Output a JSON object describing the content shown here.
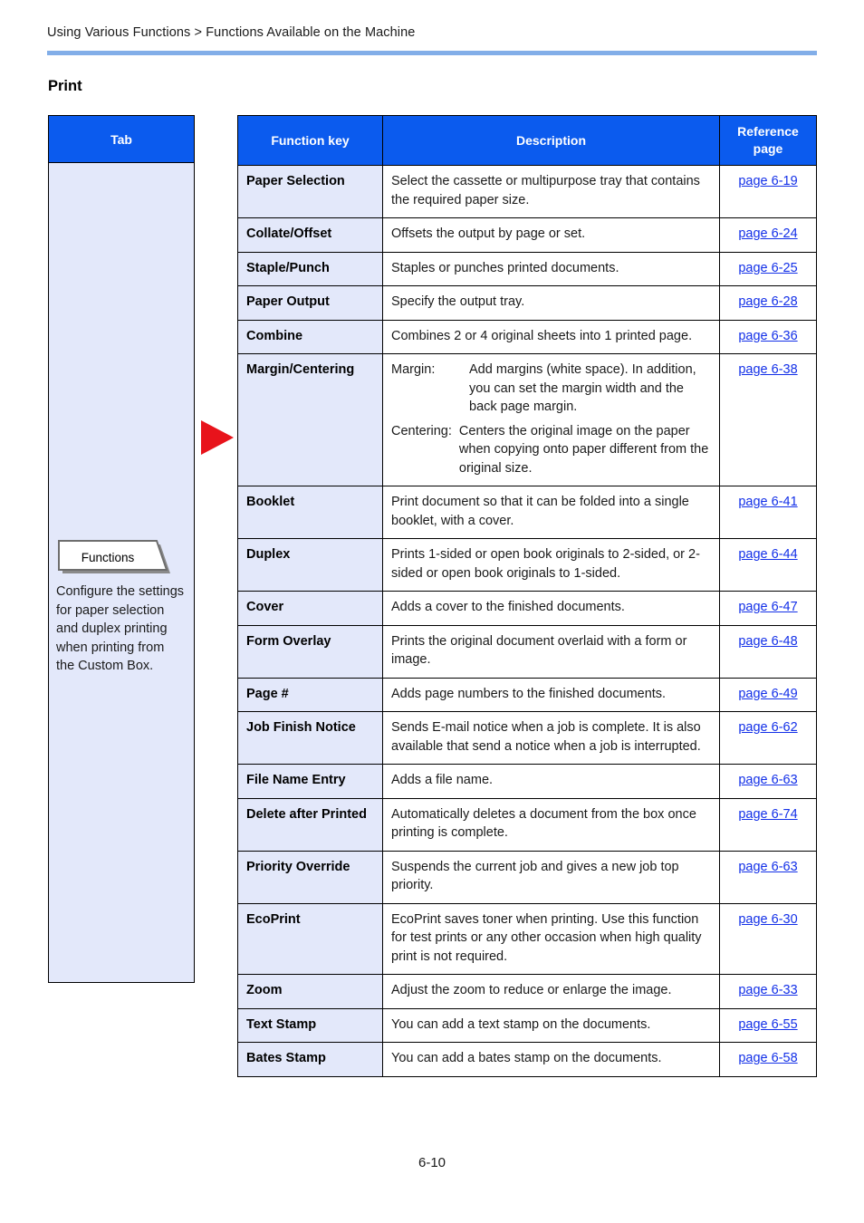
{
  "header": {
    "breadcrumb": "Using Various Functions > Functions Available on the Machine"
  },
  "section": {
    "title": "Print"
  },
  "tab_column": {
    "header": "Tab",
    "callout_label": "Functions",
    "description": "Configure the settings for paper selection and duplex printing when printing from the Custom Box."
  },
  "table": {
    "headers": {
      "function_key": "Function key",
      "description": "Description",
      "reference_page": "Reference page"
    },
    "rows": [
      {
        "key": "Paper Selection",
        "desc": "Select the cassette or multipurpose tray that contains the required paper size.",
        "ref": "page 6-19"
      },
      {
        "key": "Collate/Offset",
        "desc": "Offsets the output by page or set.",
        "ref": "page 6-24"
      },
      {
        "key": "Staple/Punch",
        "desc": "Staples or punches printed documents.",
        "ref": "page 6-25"
      },
      {
        "key": "Paper Output",
        "desc": "Specify the output tray.",
        "ref": "page 6-28"
      },
      {
        "key": "Combine",
        "desc": "Combines 2 or 4 original sheets into 1 printed page.",
        "ref": "page 6-36"
      },
      {
        "key": "Margin/Centering",
        "desc_parts": [
          {
            "label": "Margin:",
            "text": "Add margins (white space). In addition, you can set the margin width and the back page margin."
          },
          {
            "label": "Centering:",
            "text": "Centers the original image on the paper when copying onto paper different from the original size."
          }
        ],
        "ref": "page 6-38"
      },
      {
        "key": "Booklet",
        "desc": "Print document so that it can be folded into a single booklet, with a cover.",
        "ref": "page 6-41"
      },
      {
        "key": "Duplex",
        "desc": "Prints 1-sided or open book originals to 2-sided, or 2-sided or open book originals to 1-sided.",
        "ref": "page 6-44"
      },
      {
        "key": "Cover",
        "desc": "Adds a cover to the finished documents.",
        "ref": "page 6-47"
      },
      {
        "key": "Form Overlay",
        "desc": "Prints the original document overlaid with a form or image.",
        "ref": "page 6-48"
      },
      {
        "key": "Page #",
        "desc": "Adds page numbers to the finished documents.",
        "ref": "page 6-49"
      },
      {
        "key": "Job Finish Notice",
        "desc": "Sends E-mail notice when a job is complete. It is also available that send a notice when a job is interrupted.",
        "ref": "page 6-62"
      },
      {
        "key": "File Name Entry",
        "desc": "Adds a file name.",
        "ref": "page 6-63"
      },
      {
        "key": "Delete after Printed",
        "desc": "Automatically deletes a document from the box once printing is complete.",
        "ref": "page 6-74"
      },
      {
        "key": "Priority Override",
        "desc": "Suspends the current job and gives a new job top priority.",
        "ref": "page 6-63"
      },
      {
        "key": "EcoPrint",
        "desc": "EcoPrint saves toner when printing. Use this function for test prints or any other occasion when high quality print is not required.",
        "ref": "page 6-30"
      },
      {
        "key": "Zoom",
        "desc": "Adjust the zoom to reduce or enlarge the image.",
        "ref": "page 6-33"
      },
      {
        "key": "Text Stamp",
        "desc": "You can add a text stamp on the documents.",
        "ref": "page 6-55"
      },
      {
        "key": "Bates Stamp",
        "desc": "You can add a bates stamp on the documents.",
        "ref": "page 6-58"
      }
    ]
  },
  "footer": {
    "page_number": "6-10"
  },
  "colors": {
    "header_blue": "#0b5bee",
    "cell_light_blue": "#e3e8fa",
    "rule_blue": "#82aee8",
    "link_blue": "#1330e8",
    "arrow_red": "#e8131b"
  }
}
